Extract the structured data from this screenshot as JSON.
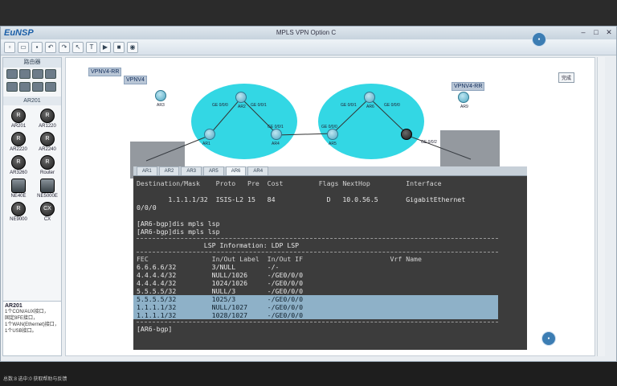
{
  "window": {
    "logo": "EuNSP",
    "title": "MPLS VPN Option C"
  },
  "left_panel": {
    "heading": "路由器",
    "subheading": "AR201",
    "devices": [
      {
        "label": "AR201"
      },
      {
        "label": "AR1220"
      },
      {
        "label": "AR2220"
      },
      {
        "label": "AR2240"
      },
      {
        "label": "AR3260"
      },
      {
        "label": "Router"
      },
      {
        "label": "NE40E"
      },
      {
        "label": "NE5000E"
      },
      {
        "label": "NE9000"
      },
      {
        "label": "CX"
      }
    ],
    "info_title": "AR201",
    "info_lines": [
      "1个CON/AUX接口，",
      "固定8FE接口，",
      "1个WAN(Ethernet)接口，",
      "1个USB接口。"
    ]
  },
  "topology": {
    "tags": [
      "VPNV4-RR",
      "VPNV4",
      "VPNV4-RR"
    ],
    "nodes": [
      "AR3",
      "AR2",
      "AR1",
      "AR4",
      "AR5",
      "AR6",
      "AR9"
    ],
    "links": [
      "GE 0/0/0",
      "GE 0/0/1",
      "GE 0/0/1",
      "GE 0/0/0",
      "GE 0/0/1",
      "GE 0/0/0",
      "GE 0/0/2"
    ],
    "button": "完成"
  },
  "terminal": {
    "tabs": [
      "AR1",
      "AR2",
      "AR3",
      "AR5",
      "AR6",
      "AR4"
    ],
    "header_line": "Destination/Mask    Proto   Pre  Cost         Flags NextHop         Interface",
    "route_line": "        1.1.1.1/32  ISIS-L2 15   84             D   10.0.56.5       GigabitEthernet",
    "route_cont": "0/0/0",
    "blank": "",
    "cmd1": "[AR6-bgp]dis mpls lsp",
    "cmd2": "[AR6-bgp]dis mpls lsp",
    "lsp_title": "                 LSP Information: LDP LSP",
    "col_head": "FEC                In/Out Label  In/Out IF                      Vrf Name",
    "rows": [
      "6.6.6.6/32         3/NULL        -/-",
      "4.4.4.4/32         NULL/1026     -/GE0/0/0",
      "4.4.4.4/32         1024/1026     -/GE0/0/0",
      "5.5.5.5/32         NULL/3        -/GE0/0/0",
      "5.5.5.5/32         1025/3        -/GE0/0/0",
      "1.1.1.1/32         NULL/1027     -/GE0/0/0",
      "1.1.1.1/32         1028/1027     -/GE0/0/0"
    ],
    "prompt": "[AR6-bgp]"
  },
  "status": {
    "text": "总数:8 选中:0  获取帮助与反馈"
  }
}
